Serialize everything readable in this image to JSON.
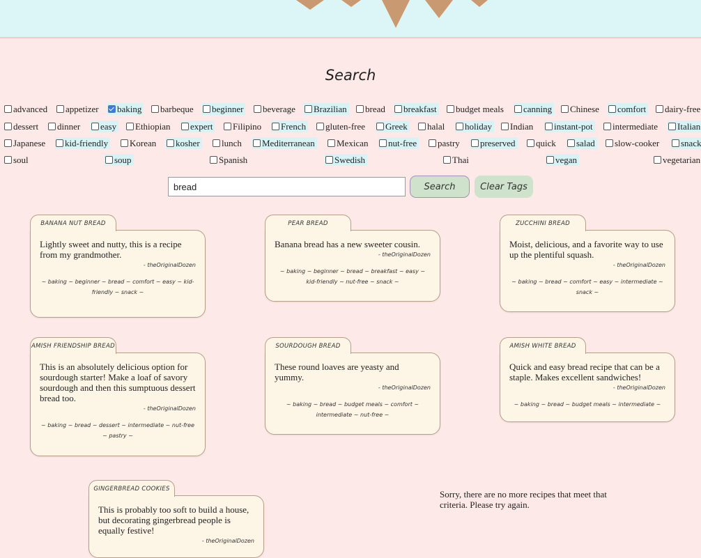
{
  "page": {
    "title": "Search"
  },
  "tags_row1": [
    {
      "label": "advanced",
      "checked": false,
      "highlight": false
    },
    {
      "label": "appetizer",
      "checked": false,
      "highlight": false
    },
    {
      "label": "baking",
      "checked": true,
      "highlight": true
    },
    {
      "label": "barbeque",
      "checked": false,
      "highlight": false
    },
    {
      "label": "beginner",
      "checked": false,
      "highlight": true
    },
    {
      "label": "beverage",
      "checked": false,
      "highlight": false
    },
    {
      "label": "Brazilian",
      "checked": false,
      "highlight": true
    },
    {
      "label": "bread",
      "checked": false,
      "highlight": false
    },
    {
      "label": "breakfast",
      "checked": false,
      "highlight": true
    },
    {
      "label": "budget meals",
      "checked": false,
      "highlight": false
    },
    {
      "label": "canning",
      "checked": false,
      "highlight": true
    },
    {
      "label": "Chinese",
      "checked": false,
      "highlight": false
    },
    {
      "label": "comfort",
      "checked": false,
      "highlight": true
    },
    {
      "label": "dairy-free",
      "checked": false,
      "highlight": false
    }
  ],
  "tags_row2": [
    {
      "label": "dessert",
      "checked": false,
      "highlight": false
    },
    {
      "label": "dinner",
      "checked": false,
      "highlight": false
    },
    {
      "label": "easy",
      "checked": false,
      "highlight": true
    },
    {
      "label": "Ethiopian",
      "checked": false,
      "highlight": false
    },
    {
      "label": "expert",
      "checked": false,
      "highlight": true
    },
    {
      "label": "Filipino",
      "checked": false,
      "highlight": false
    },
    {
      "label": "French",
      "checked": false,
      "highlight": true
    },
    {
      "label": "gluten-free",
      "checked": false,
      "highlight": false
    },
    {
      "label": "Greek",
      "checked": false,
      "highlight": true
    },
    {
      "label": "halal",
      "checked": false,
      "highlight": false
    },
    {
      "label": "holiday",
      "checked": false,
      "highlight": true
    },
    {
      "label": "Indian",
      "checked": false,
      "highlight": false
    },
    {
      "label": "instant-pot",
      "checked": false,
      "highlight": true
    },
    {
      "label": "intermediate",
      "checked": false,
      "highlight": false
    },
    {
      "label": "Italian",
      "checked": false,
      "highlight": true
    }
  ],
  "tags_row3": [
    {
      "label": "Japanese",
      "checked": false,
      "highlight": false
    },
    {
      "label": "kid-friendly",
      "checked": false,
      "highlight": true
    },
    {
      "label": "Korean",
      "checked": false,
      "highlight": false
    },
    {
      "label": "kosher",
      "checked": false,
      "highlight": true
    },
    {
      "label": "lunch",
      "checked": false,
      "highlight": false
    },
    {
      "label": "Mediterranean",
      "checked": false,
      "highlight": true
    },
    {
      "label": "Mexican",
      "checked": false,
      "highlight": false
    },
    {
      "label": "nut-free",
      "checked": false,
      "highlight": true
    },
    {
      "label": "pastry",
      "checked": false,
      "highlight": false
    },
    {
      "label": "preserved",
      "checked": false,
      "highlight": true
    },
    {
      "label": "quick",
      "checked": false,
      "highlight": false
    },
    {
      "label": "salad",
      "checked": false,
      "highlight": true
    },
    {
      "label": "slow-cooker",
      "checked": false,
      "highlight": false
    },
    {
      "label": "snack",
      "checked": false,
      "highlight": true
    }
  ],
  "tags_row4": [
    {
      "label": "soul",
      "checked": false,
      "highlight": false
    },
    {
      "label": "soup",
      "checked": false,
      "highlight": true
    },
    {
      "label": "Spanish",
      "checked": false,
      "highlight": false
    },
    {
      "label": "Swedish",
      "checked": false,
      "highlight": true
    },
    {
      "label": "Thai",
      "checked": false,
      "highlight": false
    },
    {
      "label": "vegan",
      "checked": false,
      "highlight": true
    },
    {
      "label": "vegetarian",
      "checked": false,
      "highlight": false
    }
  ],
  "search": {
    "value": "bread",
    "button_label": "Search",
    "clear_label": "Clear Tags"
  },
  "recipes": [
    {
      "name": "BANANA NUT BREAD",
      "description": "Lightly sweet and nutty, this is a recipe from my grandmother.",
      "author": "- theOriginalDozen",
      "tags": "~ baking ~ beginner ~ bread ~ comfort ~ easy ~ kid-friendly ~ snack ~"
    },
    {
      "name": "PEAR BREAD",
      "description": "Banana bread has a new sweeter cousin.",
      "author": "- theOriginalDozen",
      "tags": "~ baking ~ beginner ~ bread ~ breakfast ~ easy ~ kid-friendly ~ nut-free ~ snack ~"
    },
    {
      "name": "ZUCCHINI BREAD",
      "description": "Moist, delicious, and a favorite way to use up the plentiful squash.",
      "author": "- theOriginalDozen",
      "tags": "~ baking ~ bread ~ comfort ~ easy ~ intermediate ~ snack ~"
    },
    {
      "name": "AMISH FRIENDSHIP BREAD",
      "description": "This is an absolutely delicious option for sourdough starter! Make a loaf of savory sourdough and then this sumptuous dessert bread too.",
      "author": "- theOriginalDozen",
      "tags": "~ baking ~ bread ~ dessert ~ intermediate ~ nut-free ~ pastry ~"
    },
    {
      "name": "SOURDOUGH BREAD",
      "description": "These round loaves are yeasty and yummy.",
      "author": "- theOriginalDozen",
      "tags": "~ baking ~ bread ~ budget meals ~ comfort ~ intermediate ~ nut-free ~"
    },
    {
      "name": "AMISH WHITE BREAD",
      "description": "Quick and easy bread recipe that can be a staple. Makes excellent sandwiches!",
      "author": "- theOriginalDozen",
      "tags": "~ baking ~ bread ~ budget meals ~ intermediate ~"
    },
    {
      "name": "GINGERBREAD COOKIES",
      "description": "This is probably too soft to build a house, but decorating gingerbread people is equally festive!",
      "author": "- theOriginalDozen",
      "tags": ""
    }
  ],
  "no_more_message": "Sorry, there are no more recipes that meet that criteria. Please try again.",
  "colors": {
    "background": "#fde9e7",
    "banner": "#dcf6f8",
    "card": "#fdf5e6",
    "tag_highlight": "#d7f3f5",
    "button": "#cfe3cc"
  }
}
